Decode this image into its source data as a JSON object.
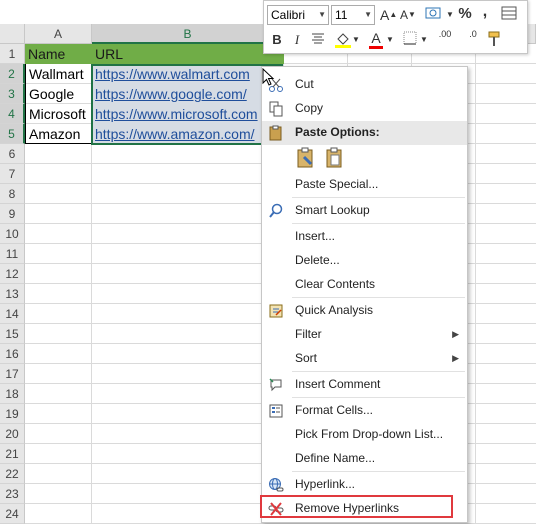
{
  "sheet": {
    "columns": [
      "A",
      "B",
      "",
      "",
      "",
      ""
    ],
    "rows": [
      "1",
      "2",
      "3",
      "4",
      "5",
      "6",
      "7",
      "8",
      "9",
      "10",
      "11",
      "12",
      "13",
      "14",
      "15",
      "16",
      "17",
      "18",
      "19",
      "20",
      "21",
      "22",
      "23",
      "24"
    ],
    "header_row": {
      "a": "Name",
      "b": "URL"
    },
    "data": [
      {
        "name": "Wallmart",
        "url": "https://www.walmart.com"
      },
      {
        "name": "Google",
        "url": "https://www.google.com/"
      },
      {
        "name": "Microsoft",
        "url": "https://www.microsoft.com"
      },
      {
        "name": "Amazon",
        "url": "https://www.amazon.com/"
      }
    ],
    "colors": {
      "header_fill": "#70ad47",
      "selection": "#217346",
      "link": "#1f4e9b"
    }
  },
  "mini_toolbar": {
    "font_name": "Calibri",
    "font_size": "11",
    "grow_font": "A",
    "shrink_font": "A",
    "percent": "%",
    "comma": ",",
    "bold": "B",
    "italic": "I",
    "font_color": "A",
    "increase_decimal": ".00",
    "decrease_decimal": ".0"
  },
  "context_menu": {
    "cut": "Cut",
    "copy": "Copy",
    "paste_options": "Paste Options:",
    "paste_special": "Paste Special...",
    "smart_lookup": "Smart Lookup",
    "insert": "Insert...",
    "delete": "Delete...",
    "clear_contents": "Clear Contents",
    "quick_analysis": "Quick Analysis",
    "filter": "Filter",
    "sort": "Sort",
    "insert_comment": "Insert Comment",
    "format_cells": "Format Cells...",
    "pick_from_list": "Pick From Drop-down List...",
    "define_name": "Define Name...",
    "hyperlink": "Hyperlink...",
    "remove_hyperlinks": "Remove Hyperlinks",
    "highlight_color": "#e0393e"
  }
}
